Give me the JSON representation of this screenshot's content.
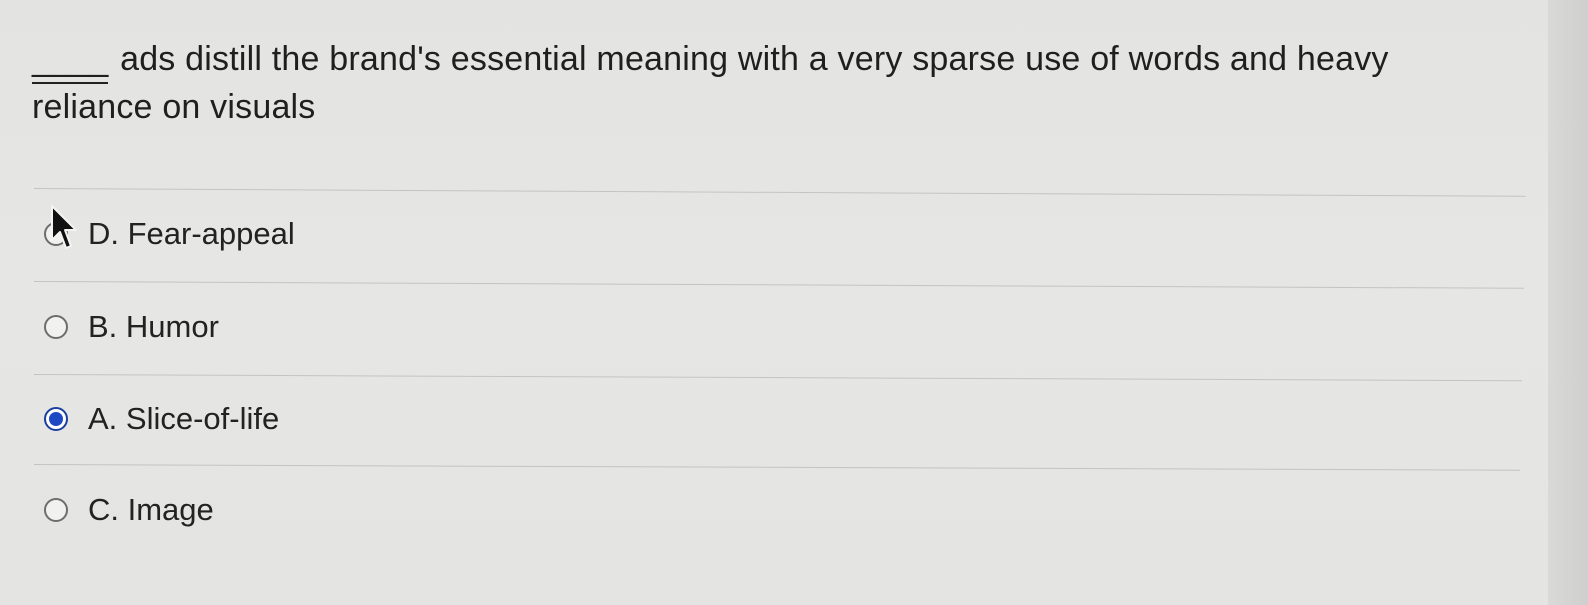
{
  "question": {
    "blank": "____",
    "text": "ads distill the brand's essential meaning with a very sparse use of words and heavy reliance on visuals"
  },
  "options": [
    {
      "label": "D. Fear-appeal",
      "selected": false
    },
    {
      "label": "B. Humor",
      "selected": false
    },
    {
      "label": "A. Slice-of-life",
      "selected": true
    },
    {
      "label": "C. Image",
      "selected": false
    }
  ],
  "colors": {
    "selected_radio": "#1e47c4",
    "background": "#e5e5e3"
  },
  "icons": {
    "pointer": "mouse-pointer-icon"
  }
}
